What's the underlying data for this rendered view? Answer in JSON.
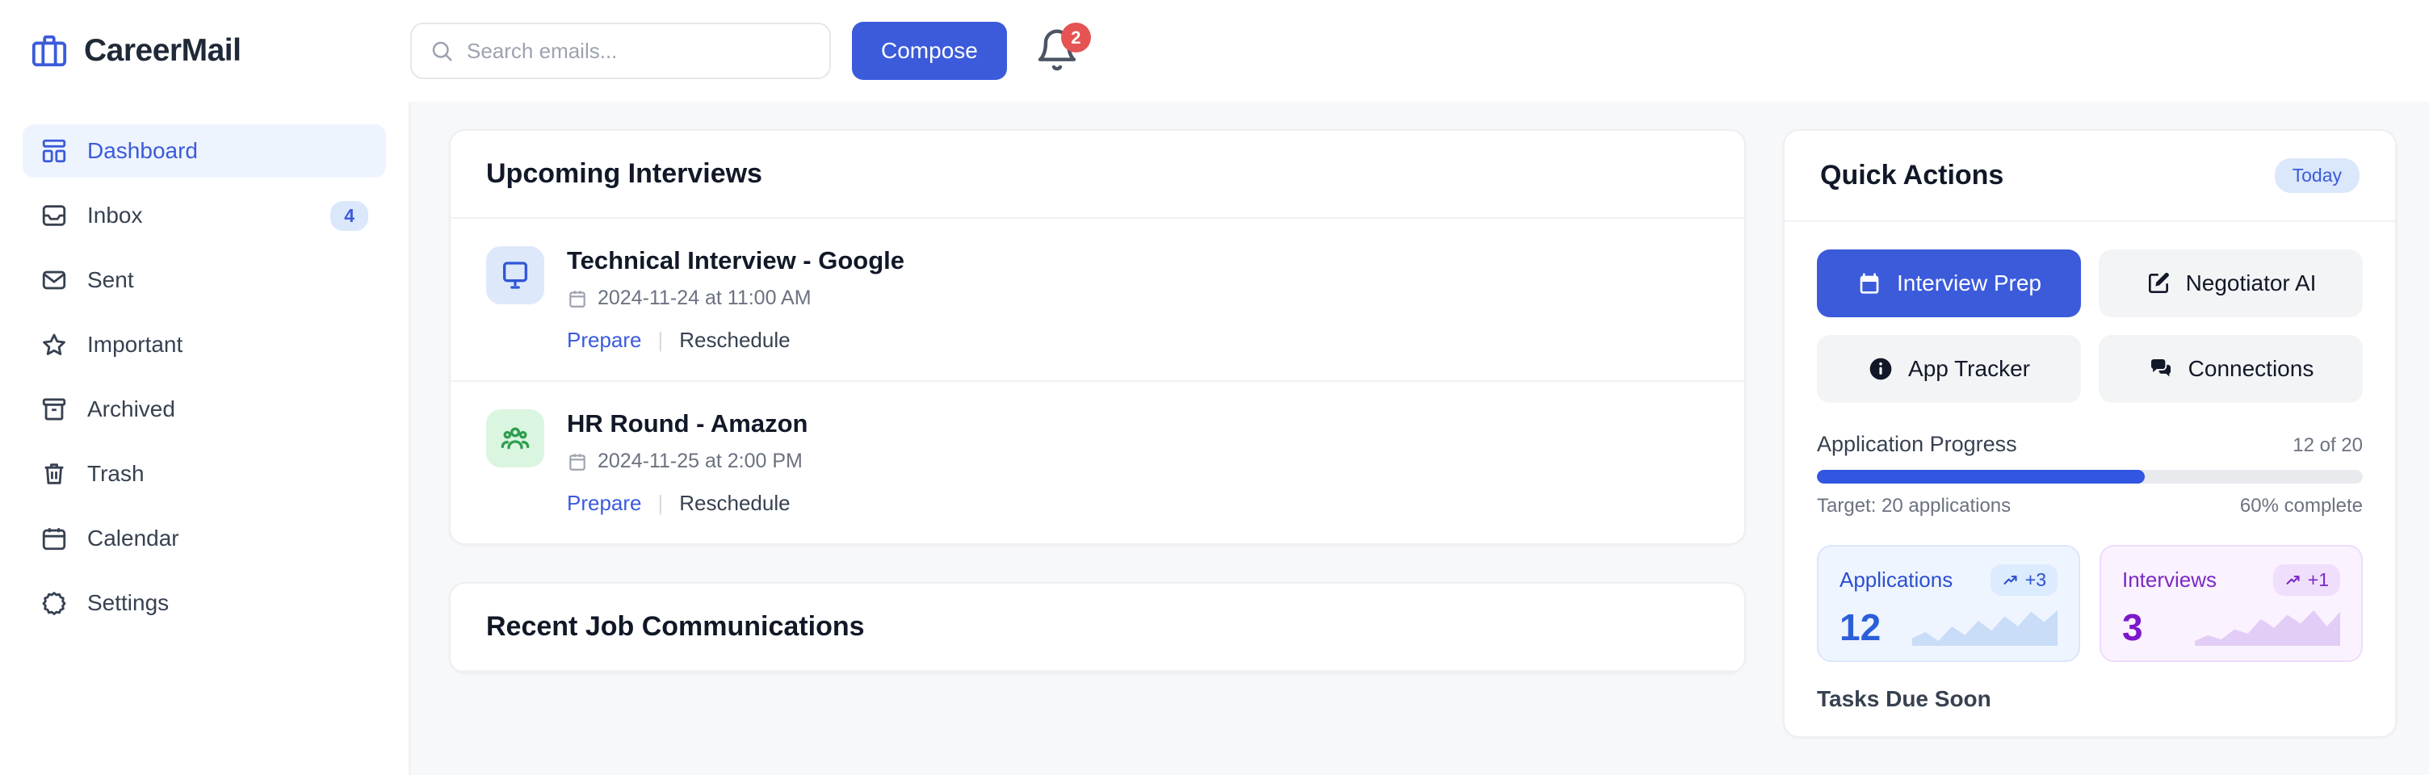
{
  "app": {
    "name": "CareerMail",
    "logo_icon": "briefcase-icon",
    "accent": "#3b5bdb"
  },
  "header": {
    "search": {
      "placeholder": "Search emails...",
      "value": "",
      "icon": "search-icon"
    },
    "compose_label": "Compose",
    "notifications": {
      "icon": "bell-icon",
      "count": "2",
      "badge_color": "#e55353"
    }
  },
  "sidebar": {
    "items": [
      {
        "label": "Dashboard",
        "icon": "dashboard-icon",
        "active": true,
        "badge": ""
      },
      {
        "label": "Inbox",
        "icon": "inbox-icon",
        "active": false,
        "badge": "4"
      },
      {
        "label": "Sent",
        "icon": "envelope-icon",
        "active": false,
        "badge": ""
      },
      {
        "label": "Important",
        "icon": "star-icon",
        "active": false,
        "badge": ""
      },
      {
        "label": "Archived",
        "icon": "archive-icon",
        "active": false,
        "badge": ""
      },
      {
        "label": "Trash",
        "icon": "trash-icon",
        "active": false,
        "badge": ""
      },
      {
        "label": "Calendar",
        "icon": "calendar-icon",
        "active": false,
        "badge": ""
      },
      {
        "label": "Settings",
        "icon": "gear-icon",
        "active": false,
        "badge": ""
      }
    ]
  },
  "interviews": {
    "title": "Upcoming Interviews",
    "items": [
      {
        "title": "Technical Interview - Google",
        "datetime": "2024-11-24 at 11:00 AM",
        "icon": "monitor-icon",
        "icon_tone": "blue",
        "prepare_label": "Prepare",
        "reschedule_label": "Reschedule"
      },
      {
        "title": "HR Round - Amazon",
        "datetime": "2024-11-25 at 2:00 PM",
        "icon": "people-icon",
        "icon_tone": "green",
        "prepare_label": "Prepare",
        "reschedule_label": "Reschedule"
      }
    ]
  },
  "communications": {
    "title": "Recent Job Communications"
  },
  "quick_actions": {
    "title": "Quick Actions",
    "badge": "Today",
    "buttons": [
      {
        "label": "Interview Prep",
        "icon": "calendar-icon",
        "style": "primary"
      },
      {
        "label": "Negotiator AI",
        "icon": "edit-icon",
        "style": "ghost"
      },
      {
        "label": "App Tracker",
        "icon": "info-icon",
        "style": "ghost"
      },
      {
        "label": "Connections",
        "icon": "chat-icon",
        "style": "ghost"
      }
    ],
    "progress": {
      "label": "Application Progress",
      "count_text": "12 of 20",
      "target_text": "Target: 20 applications",
      "percent_text": "60% complete",
      "percent": 60
    },
    "stats": [
      {
        "name": "Applications",
        "value": "12",
        "delta": "+3",
        "tone": "blue",
        "spark": [
          14,
          22,
          10,
          30,
          18,
          38,
          24,
          44,
          30,
          50,
          36,
          52
        ]
      },
      {
        "name": "Interviews",
        "value": "3",
        "delta": "+1",
        "tone": "purple",
        "spark": [
          10,
          18,
          12,
          26,
          20,
          40,
          28,
          46,
          34,
          52,
          30,
          50
        ]
      }
    ],
    "tasks_title": "Tasks Due Soon"
  }
}
